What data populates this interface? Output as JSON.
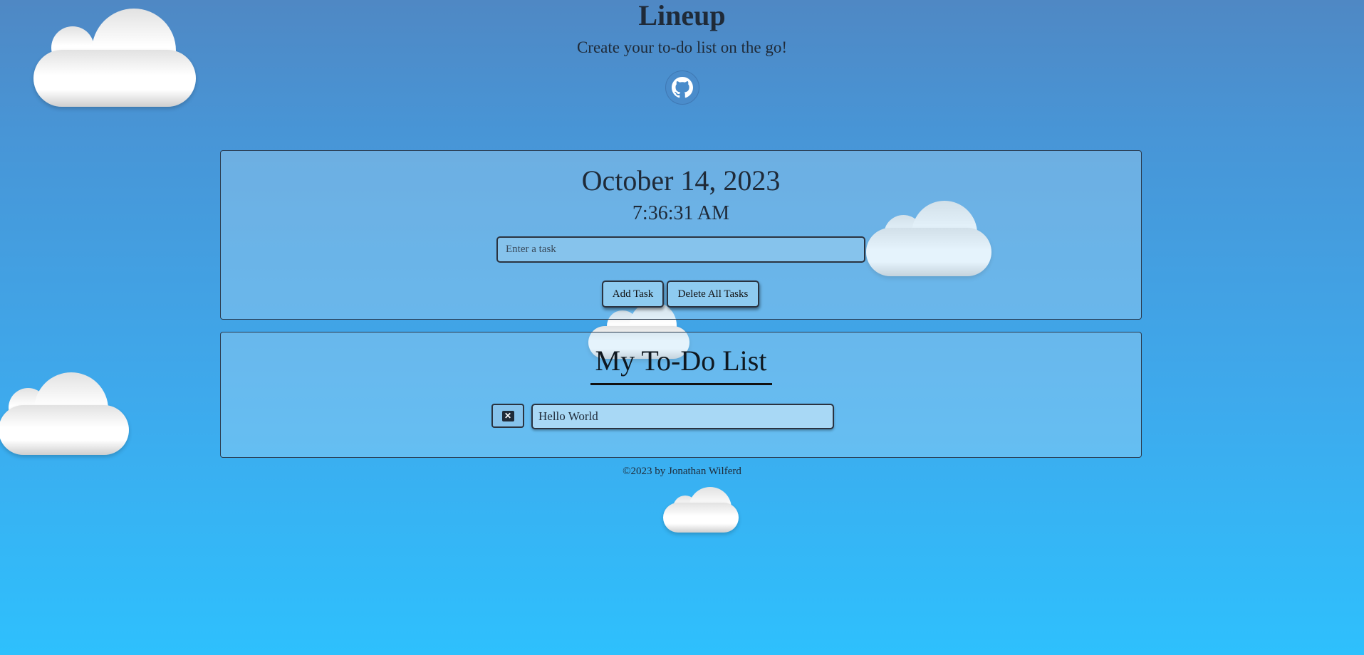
{
  "header": {
    "title": "Lineup",
    "subtitle": "Create your to-do list on the go!",
    "github_icon": "github-icon"
  },
  "planner": {
    "date": "October 14, 2023",
    "time": "7:36:31 AM",
    "task_input": {
      "placeholder": "Enter a task",
      "value": ""
    },
    "add_button": "Add Task",
    "delete_all_button": "Delete All Tasks"
  },
  "todo": {
    "title": "My To-Do List",
    "tasks": [
      {
        "delete_icon": "close-icon",
        "text": "Hello World"
      }
    ]
  },
  "footer": {
    "copyright": "©2023 by Jonathan Wilferd"
  },
  "colors": {
    "background_top": "#4f88c4",
    "background_bottom": "#2ec0fd",
    "panel_border": "#2a3a4d",
    "text": "#1f2a38"
  }
}
